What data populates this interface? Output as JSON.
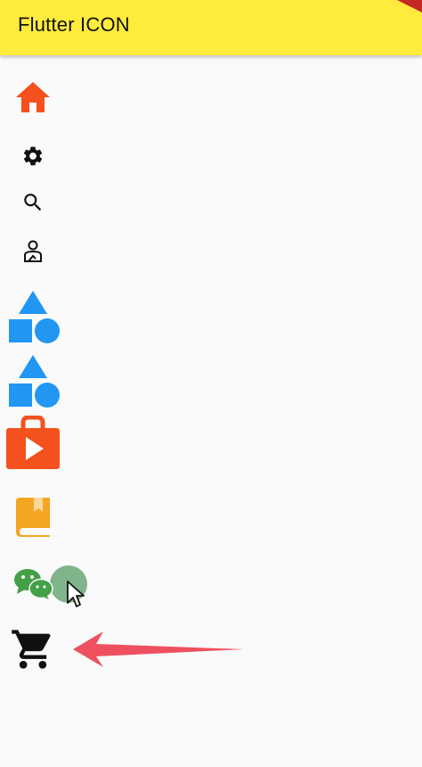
{
  "appbar": {
    "title": "Flutter ICON",
    "background_color": "#ffeb3b"
  },
  "icons": [
    {
      "name": "home-icon",
      "color": "#f4511e"
    },
    {
      "name": "gear-icon",
      "color": "#111111"
    },
    {
      "name": "search-icon",
      "color": "#111111"
    },
    {
      "name": "person-outline-icon",
      "color": "#111111"
    },
    {
      "name": "shapes-icon",
      "color": "#2196f3"
    },
    {
      "name": "shapes-icon",
      "color": "#2196f3"
    },
    {
      "name": "play-store-bag-icon",
      "color": "#f4511e"
    },
    {
      "name": "book-icon",
      "color": "#f4a623"
    },
    {
      "name": "wechat-icon",
      "color": "#43a047"
    },
    {
      "name": "shopping-cart-icon",
      "color": "#111111"
    }
  ],
  "annotation": {
    "arrow_color": "#ef5060"
  }
}
